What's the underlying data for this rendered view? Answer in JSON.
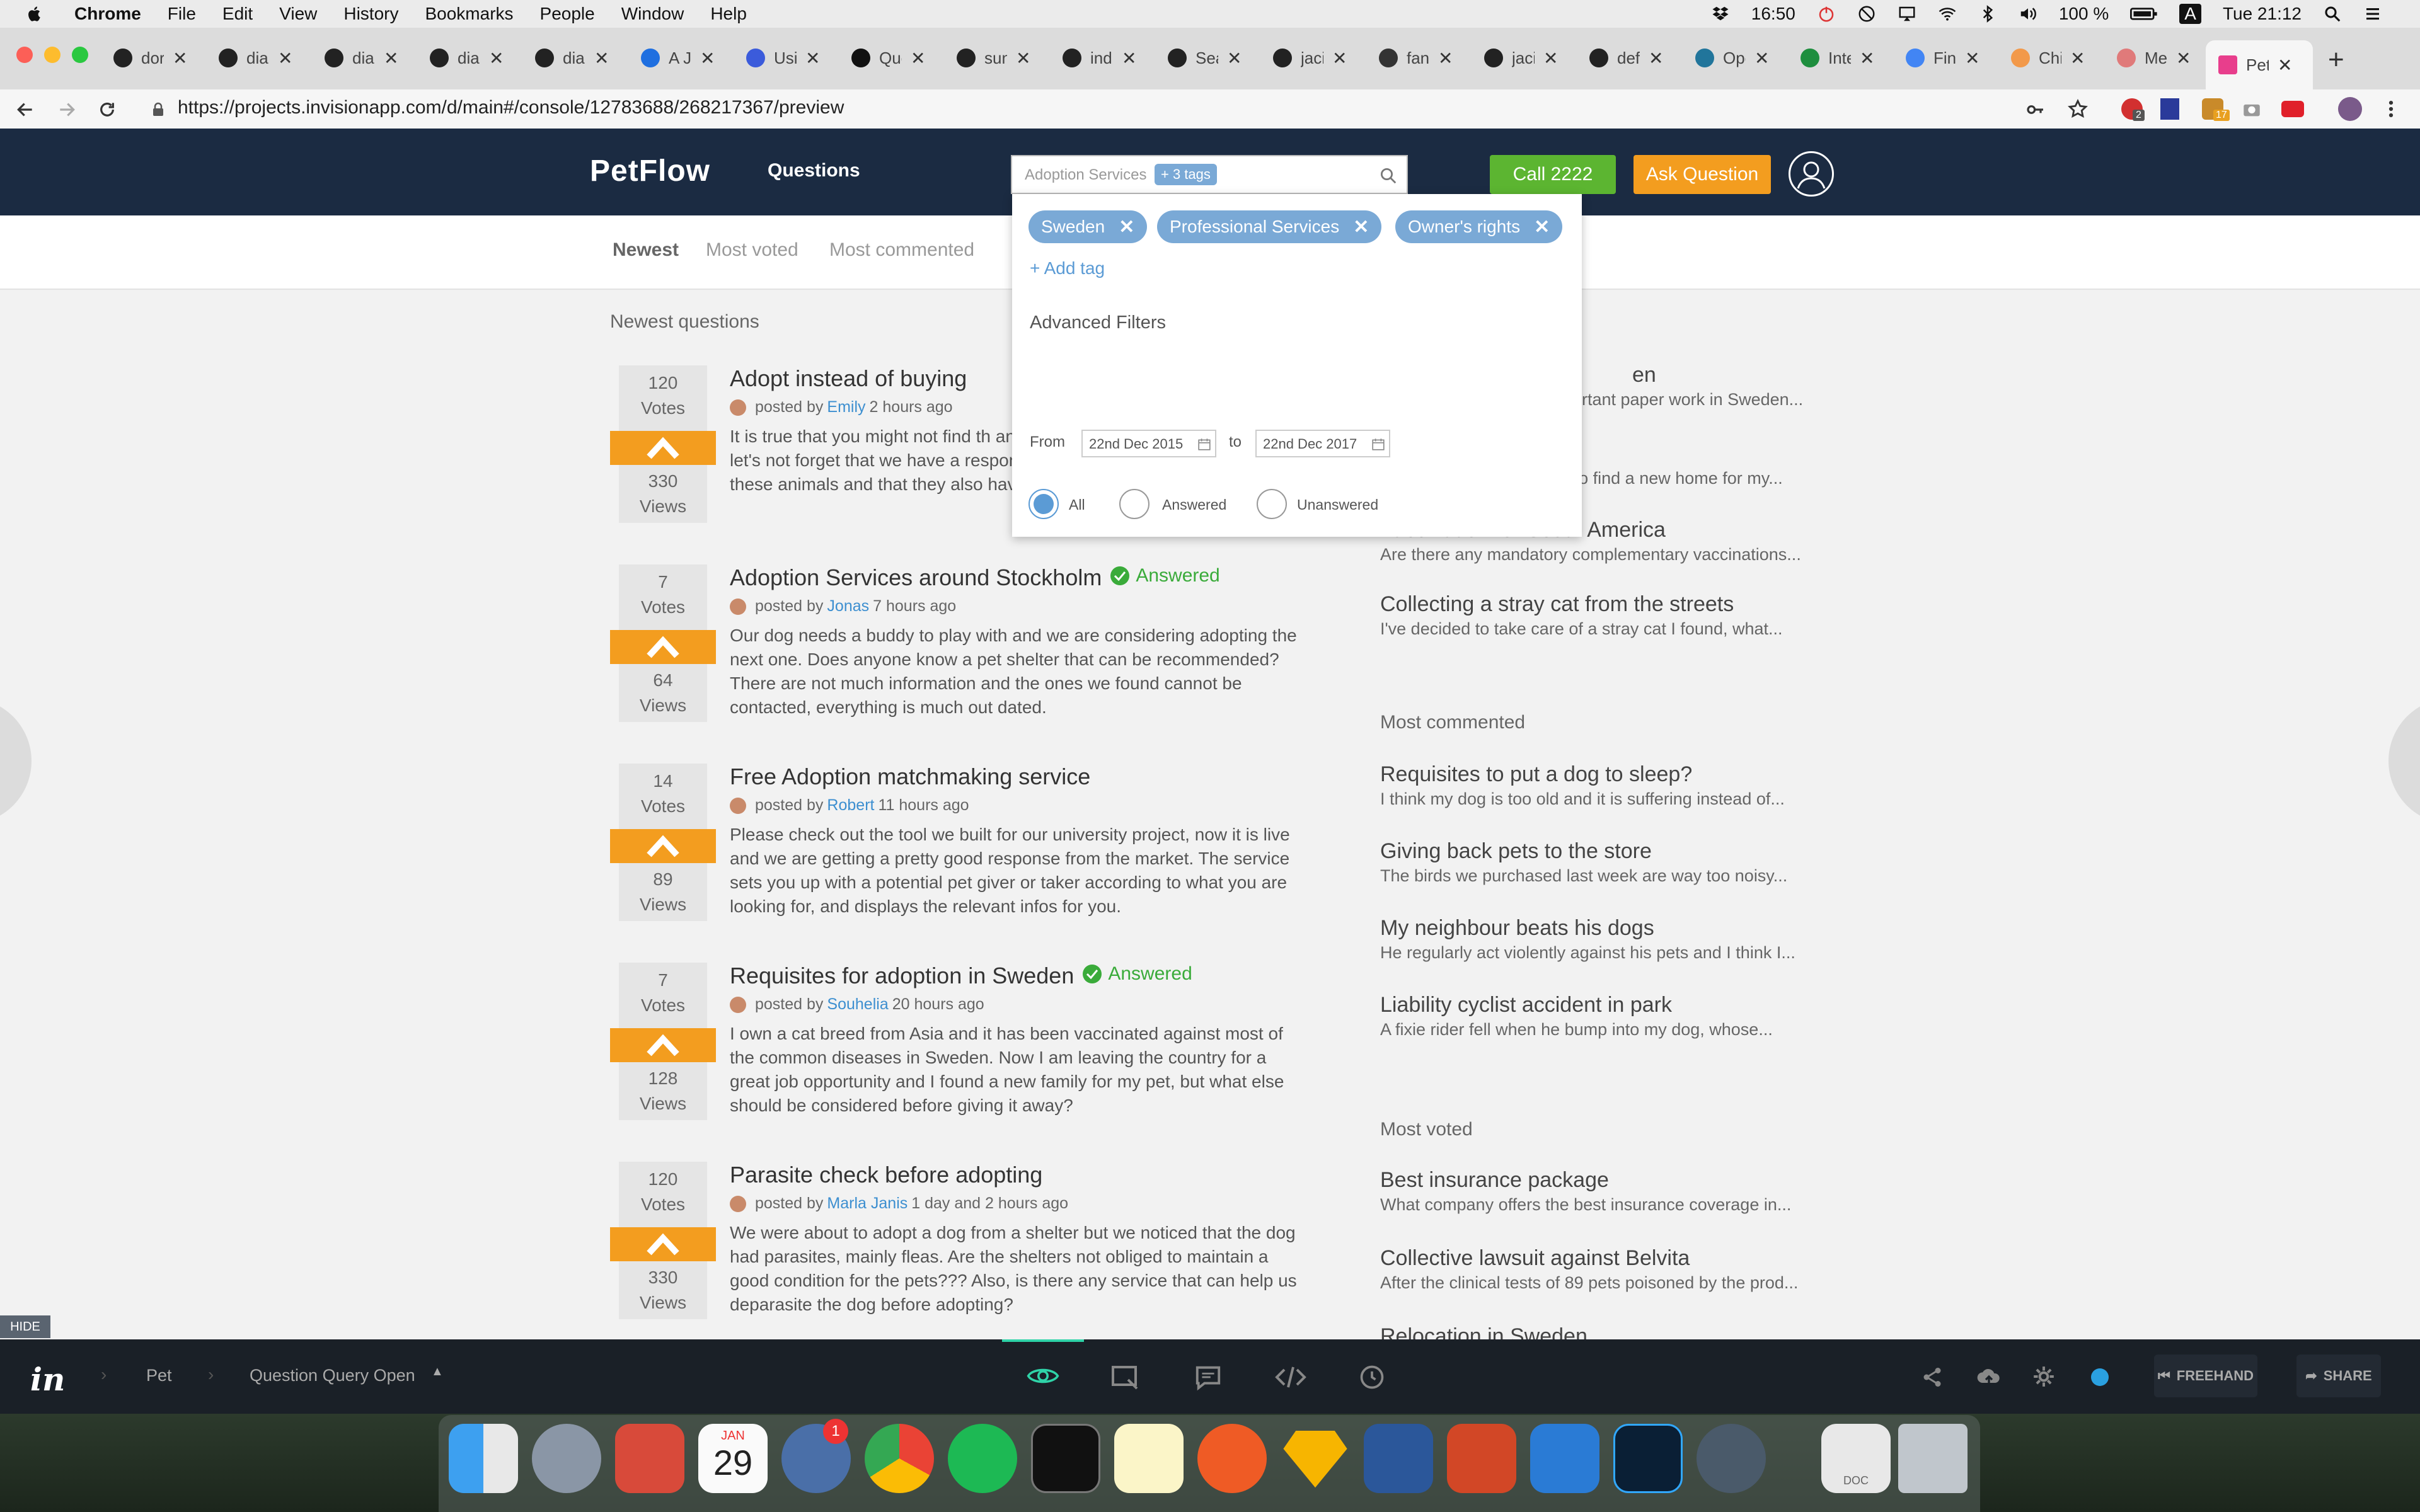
{
  "menubar": {
    "app_name": "Chrome",
    "items": [
      "File",
      "Edit",
      "View",
      "History",
      "Bookmarks",
      "People",
      "Window",
      "Help"
    ],
    "time_left": "16:50",
    "battery": "100 %",
    "input_source": "A",
    "datetime": "Tue 21:12"
  },
  "tabs": [
    {
      "label": "dor",
      "icon": "github-icon",
      "color": "#222222"
    },
    {
      "label": "dial",
      "icon": "github-icon",
      "color": "#222222"
    },
    {
      "label": "dial",
      "icon": "github-icon",
      "color": "#222222"
    },
    {
      "label": "dial",
      "icon": "github-icon",
      "color": "#222222"
    },
    {
      "label": "dial",
      "icon": "github-icon",
      "color": "#222222"
    },
    {
      "label": "A Ju",
      "icon": "a-icon",
      "color": "#1f6fe0"
    },
    {
      "label": "Usi",
      "icon": "ibm-icon",
      "color": "#3b5bdb"
    },
    {
      "label": "Que",
      "icon": "medium-icon",
      "color": "#111111"
    },
    {
      "label": "sun",
      "icon": "github-icon",
      "color": "#222222"
    },
    {
      "label": "indi",
      "icon": "github-icon",
      "color": "#222222"
    },
    {
      "label": "Sea",
      "icon": "github-icon",
      "color": "#222222"
    },
    {
      "label": "jaci",
      "icon": "github-icon",
      "color": "#222222"
    },
    {
      "label": "fan",
      "icon": "tab-icon",
      "color": "#333333"
    },
    {
      "label": "jaci",
      "icon": "github-icon",
      "color": "#222222"
    },
    {
      "label": "def",
      "icon": "github-icon",
      "color": "#222222"
    },
    {
      "label": "Ope",
      "icon": "wordpress-icon",
      "color": "#21759b"
    },
    {
      "label": "Inte",
      "icon": "sheets-icon",
      "color": "#1e8e3e"
    },
    {
      "label": "Fin",
      "icon": "docs-icon",
      "color": "#4285f4"
    },
    {
      "label": "Chi",
      "icon": "tab-icon",
      "color": "#f2994a"
    },
    {
      "label": "Me",
      "icon": "tab-icon",
      "color": "#e07a7a"
    }
  ],
  "active_tab": {
    "label": "Pet",
    "icon": "invision-icon",
    "color": "#e83e8c"
  },
  "address": {
    "url": "https://projects.invisionapp.com/d/main#/console/12783688/268217367/preview"
  },
  "extension_badges": {
    "first": "2",
    "second": "17"
  },
  "header": {
    "logo": "PetFlow",
    "nav_questions": "Questions",
    "search_placeholder": "Adoption Services",
    "search_tag_count": "+ 3 tags",
    "call_label": "Call 2222",
    "ask_label": "Ask Question"
  },
  "sort": {
    "newest": "Newest",
    "most_voted": "Most voted",
    "most_commented": "Most commented"
  },
  "main": {
    "section_title": "Newest questions",
    "posted_by": "posted by",
    "questions": [
      {
        "votes": "120",
        "votes_label": "Votes",
        "views": "330",
        "views_label": "Views",
        "title": "Adopt instead of buying",
        "answered": "",
        "author": "Emily",
        "time": "2 hours ago",
        "body": "It is true that you might not find th and that the pet you bring home is let's not forget that we have a responsibility of providing a better living to these animals and that they also have a right to live better."
      },
      {
        "votes": "7",
        "votes_label": "Votes",
        "views": "64",
        "views_label": "Views",
        "title": "Adoption Services around Stockholm",
        "answered": "Answered",
        "author": "Jonas",
        "time": "7 hours ago",
        "body": "Our dog needs a buddy to play with and we are considering adopting the next one. Does anyone know a pet shelter that can be recommended? There are not much information and the ones we found cannot be contacted, everything is much out dated."
      },
      {
        "votes": "14",
        "votes_label": "Votes",
        "views": "89",
        "views_label": "Views",
        "title": "Free Adoption matchmaking service",
        "answered": "",
        "author": "Robert",
        "time": "11 hours ago",
        "body": "Please check out the tool we built for our university project, now it is live and we are getting a pretty good response from the market. The service sets you up with a potential pet giver or taker according to what you are looking for, and displays the relevant infos for you."
      },
      {
        "votes": "7",
        "votes_label": "Votes",
        "views": "128",
        "views_label": "Views",
        "title": "Requisites for adoption in Sweden",
        "answered": "Answered",
        "author": "Souhelia",
        "time": "20 hours ago",
        "body": "I own a cat breed from Asia and it has been vaccinated against most of the common diseases in Sweden. Now I am leaving the country for a great job opportunity and I found a new family for my pet, but what else should be considered before giving it away?"
      },
      {
        "votes": "120",
        "votes_label": "Votes",
        "views": "330",
        "views_label": "Views",
        "title": "Parasite check before adopting",
        "answered": "",
        "author": "Marla Janis",
        "time": "1 day and 2 hours ago",
        "body": "We were about to adopt a dog from a shelter but we noticed that the dog had parasites, mainly fleas. Are the shelters not obliged to maintain a good condition for the pets??? Also, is there any service that can help us deparasite the dog before adopting?"
      }
    ]
  },
  "sidebar": {
    "partial": [
      {
        "title": "en",
        "desc": "rtant paper work in Sweden..."
      },
      {
        "title": "",
        "desc": "I am looking for a service to find a new home for my..."
      }
    ],
    "top": [
      {
        "title": "Vaccination for South America",
        "desc": "Are there any mandatory complementary vaccinations..."
      },
      {
        "title": "Collecting a stray cat from the streets",
        "desc": "I've decided to take care of a stray cat I found, what..."
      }
    ],
    "most_commented_title": "Most commented",
    "most_commented": [
      {
        "title": "Requisites to put a dog to sleep?",
        "desc": "I think my dog is too old and it is suffering instead of..."
      },
      {
        "title": "Giving back pets to the store",
        "desc": "The birds we purchased last week are way too noisy..."
      },
      {
        "title": "My neighbour beats his dogs",
        "desc": "He regularly act violently against his pets and I think I..."
      },
      {
        "title": "Liability cyclist accident in park",
        "desc": "A fixie rider fell when he bump into my dog, whose..."
      }
    ],
    "most_voted_title": "Most voted",
    "most_voted": [
      {
        "title": "Best insurance package",
        "desc": "What company offers the best insurance coverage in..."
      },
      {
        "title": "Collective lawsuit against Belvita",
        "desc": "After the clinical tests of 89 pets poisoned by the prod..."
      },
      {
        "title": "Relocation in Sweden",
        "desc": ""
      }
    ]
  },
  "dropdown": {
    "tags": [
      "Sweden",
      "Professional Services",
      "Owner's rights"
    ],
    "add_tag": "+ Add tag",
    "advanced_title": "Advanced Filters",
    "from_label": "From",
    "from_date": "22nd Dec 2015",
    "to_label": "to",
    "to_date": "22nd Dec 2017",
    "options": [
      "All",
      "Answered",
      "Unanswered"
    ],
    "selected": "All"
  },
  "invision_bar": {
    "hide_label": "HIDE",
    "project": "Pet",
    "screen": "Question Query Open",
    "freehand": "FREEHAND",
    "share": "SHARE"
  },
  "dock": {
    "calendar_month": "JAN",
    "calendar_day": "29",
    "notification_badge": "1",
    "doc_label": "DOC",
    "apps": [
      "finder",
      "launchpad",
      "bookmarks",
      "calendar",
      "app",
      "chrome",
      "spotify",
      "terminal",
      "notes",
      "postman",
      "sketch",
      "word",
      "powerpoint",
      "vscode",
      "photoshop",
      "quicktime",
      "document",
      "trash"
    ]
  },
  "colors": {
    "header_bg": "#1b2b42",
    "orange": "#f39d1f",
    "green": "#5cb531",
    "tag_blue": "#7aa9d6",
    "link_blue": "#3d8fd0",
    "answered_green": "#3aab3a"
  }
}
